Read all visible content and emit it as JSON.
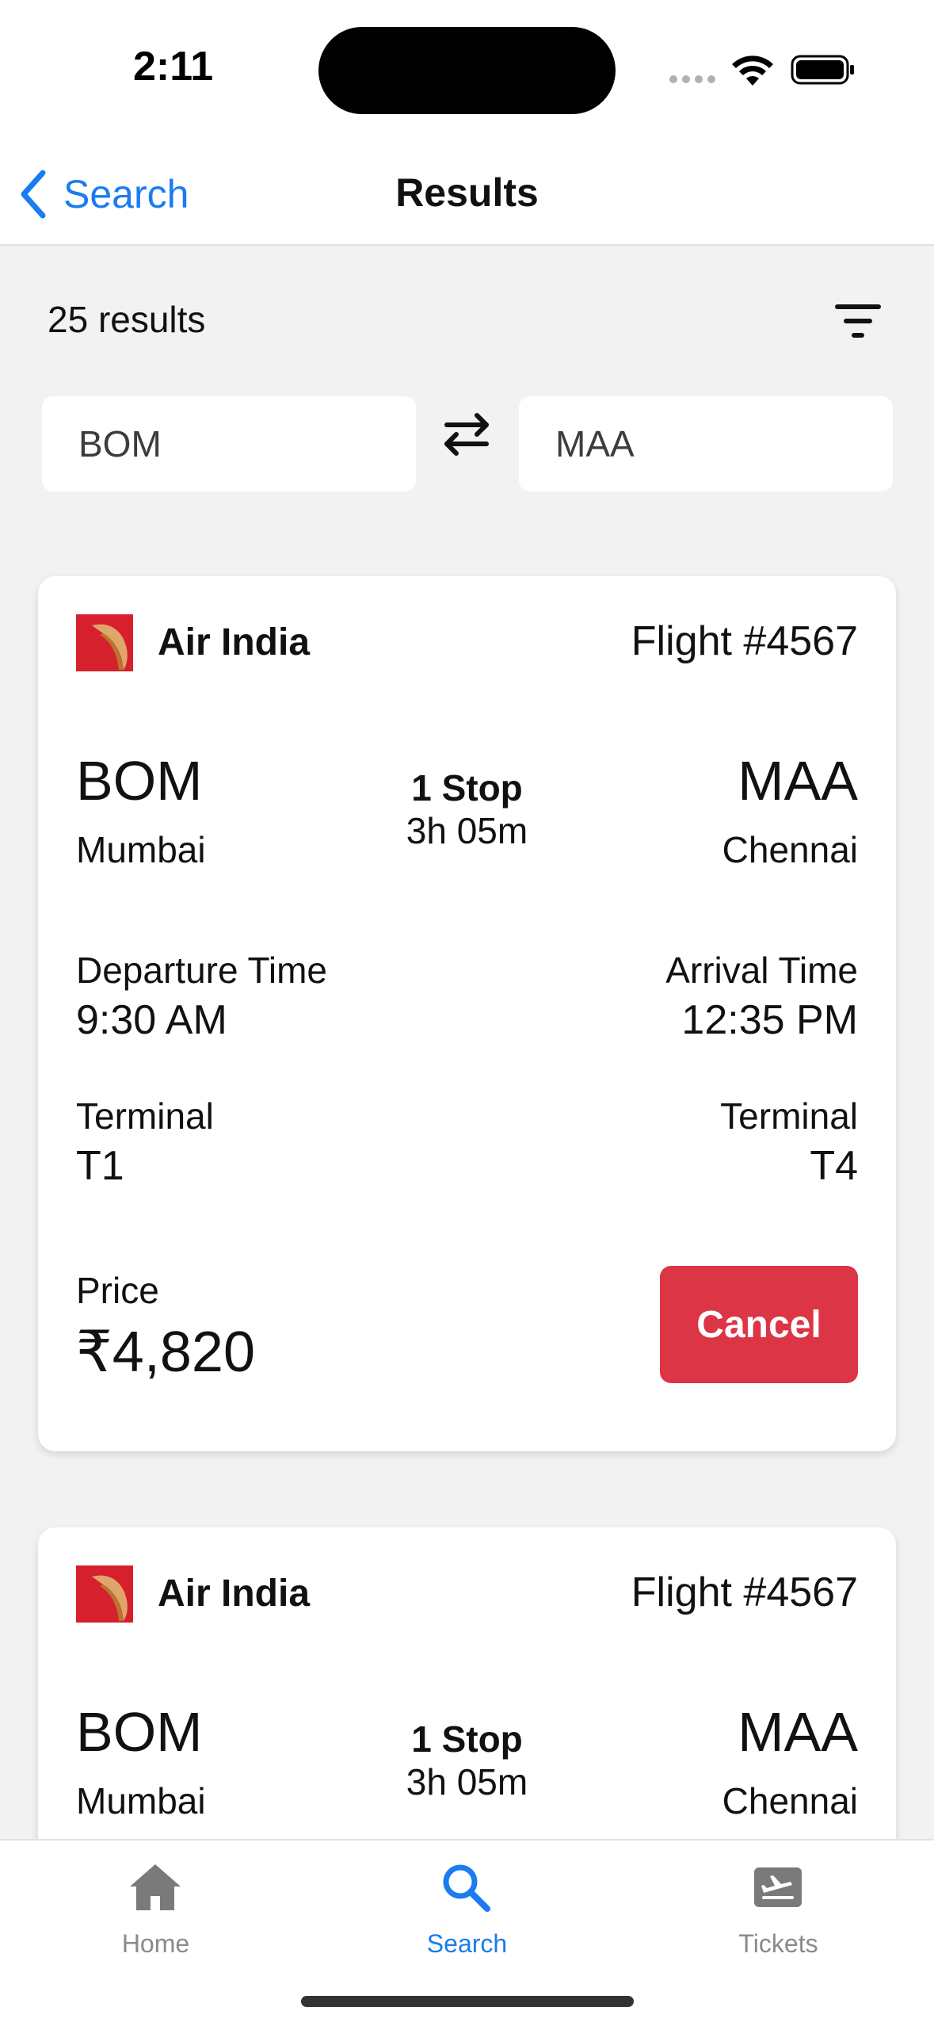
{
  "status_bar": {
    "time": "2:11"
  },
  "nav": {
    "back_label": "Search",
    "title": "Results"
  },
  "results": {
    "count_label": "25 results"
  },
  "route": {
    "from": "BOM",
    "to": "MAA"
  },
  "flights": [
    {
      "airline": "Air India",
      "flight_number": "Flight #4567",
      "origin_code": "BOM",
      "origin_city": "Mumbai",
      "destination_code": "MAA",
      "destination_city": "Chennai",
      "stops": "1 Stop",
      "duration": "3h 05m",
      "departure_label": "Departure Time",
      "departure_time": "9:30 AM",
      "arrival_label": "Arrival Time",
      "arrival_time": "12:35 PM",
      "origin_terminal_label": "Terminal",
      "origin_terminal": "T1",
      "destination_terminal_label": "Terminal",
      "destination_terminal": "T4",
      "price_label": "Price",
      "price": "₹4,820",
      "action_label": "Cancel"
    },
    {
      "airline": "Air India",
      "flight_number": "Flight #4567",
      "origin_code": "BOM",
      "origin_city": "Mumbai",
      "destination_code": "MAA",
      "destination_city": "Chennai",
      "stops": "1 Stop",
      "duration": "3h 05m"
    }
  ],
  "tab_bar": {
    "tabs": [
      {
        "label": "Home",
        "icon": "home-icon"
      },
      {
        "label": "Search",
        "icon": "search-icon",
        "active": true
      },
      {
        "label": "Tickets",
        "icon": "ticket-icon"
      }
    ]
  },
  "colors": {
    "accent": "#1a7cf0",
    "danger": "#dc3545",
    "background": "#f2f2f2",
    "airline_red": "#d6202e"
  }
}
